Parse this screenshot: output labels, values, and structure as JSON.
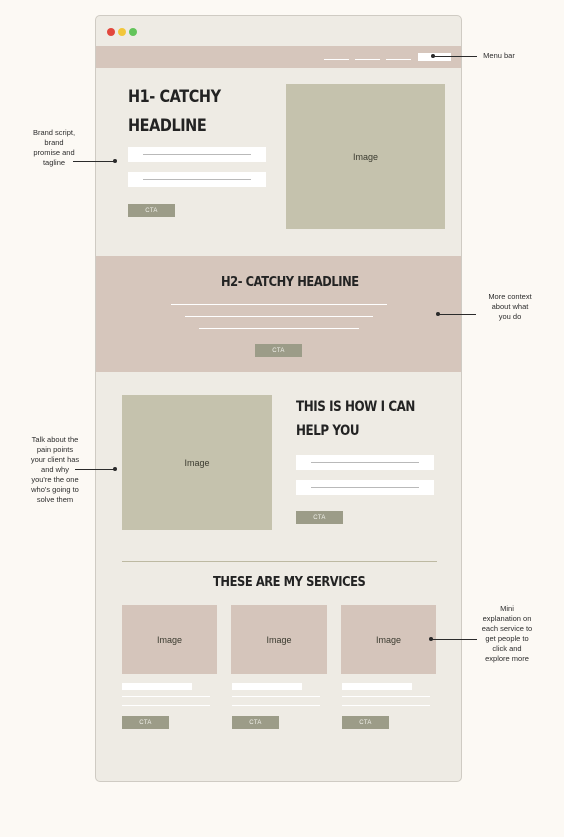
{
  "menu_bar": {
    "annotation": "Menu bar"
  },
  "hero": {
    "headline_line1": "H1- CATCHY",
    "headline_line2": "HEADLINE",
    "image_label": "Image",
    "cta_label": "CTA",
    "annotation": [
      "Brand script,",
      "brand",
      "promise and",
      "tagline"
    ]
  },
  "context": {
    "headline": "H2- CATCHY HEADLINE",
    "cta_label": "CTA",
    "annotation": [
      "More context",
      "about what",
      "you do"
    ]
  },
  "help": {
    "image_label": "Image",
    "headline_line1": "THIS IS HOW I CAN",
    "headline_line2": "HELP YOU",
    "cta_label": "CTA",
    "annotation": [
      "Talk about the",
      "pain points",
      "your client has",
      "and why",
      "you're the one",
      "who's going to",
      "solve them"
    ]
  },
  "services": {
    "headline": "THESE ARE MY SERVICES",
    "cards": [
      {
        "image_label": "Image",
        "cta_label": "CTA"
      },
      {
        "image_label": "Image",
        "cta_label": "CTA"
      },
      {
        "image_label": "Image",
        "cta_label": "CTA"
      }
    ],
    "annotation": [
      "Mini",
      "explanation on",
      "each service to",
      "get people to",
      "click and",
      "explore more"
    ]
  },
  "colors": {
    "page_background": "#fcf9f4",
    "frame_background": "#eeebe4",
    "blush": "#d6c6bc",
    "sage": "#c5c2ad",
    "cta": "#9c9c88"
  }
}
